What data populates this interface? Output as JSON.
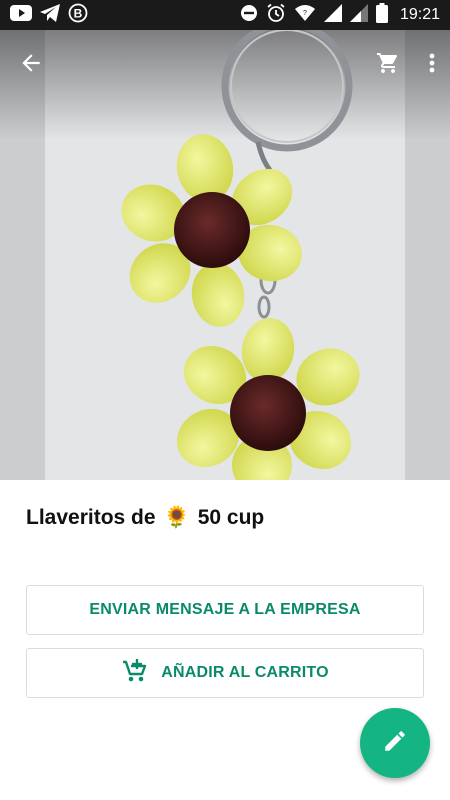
{
  "status_bar": {
    "time": "19:21",
    "icons": [
      "youtube-icon",
      "telegram-icon",
      "b-badge-icon",
      "do-not-disturb-icon",
      "alarm-icon",
      "wifi-icon",
      "signal-icon",
      "signal-icon",
      "battery-icon"
    ]
  },
  "toolbar": {
    "back_icon": "arrow-back-icon",
    "cart_icon": "cart-icon",
    "menu_icon": "more-vert-icon"
  },
  "product": {
    "name": "Llaveritos de",
    "emoji": "🌻",
    "price": "50 cup"
  },
  "actions": {
    "message_label": "ENVIAR MENSAJE A LA EMPRESA",
    "add_cart_label": "AÑADIR AL CARRITO",
    "edit_icon": "edit-pencil-icon"
  },
  "colors": {
    "accent": "#0b8a6a",
    "fab": "#15b483",
    "statusbar": "#1a1a1a"
  }
}
